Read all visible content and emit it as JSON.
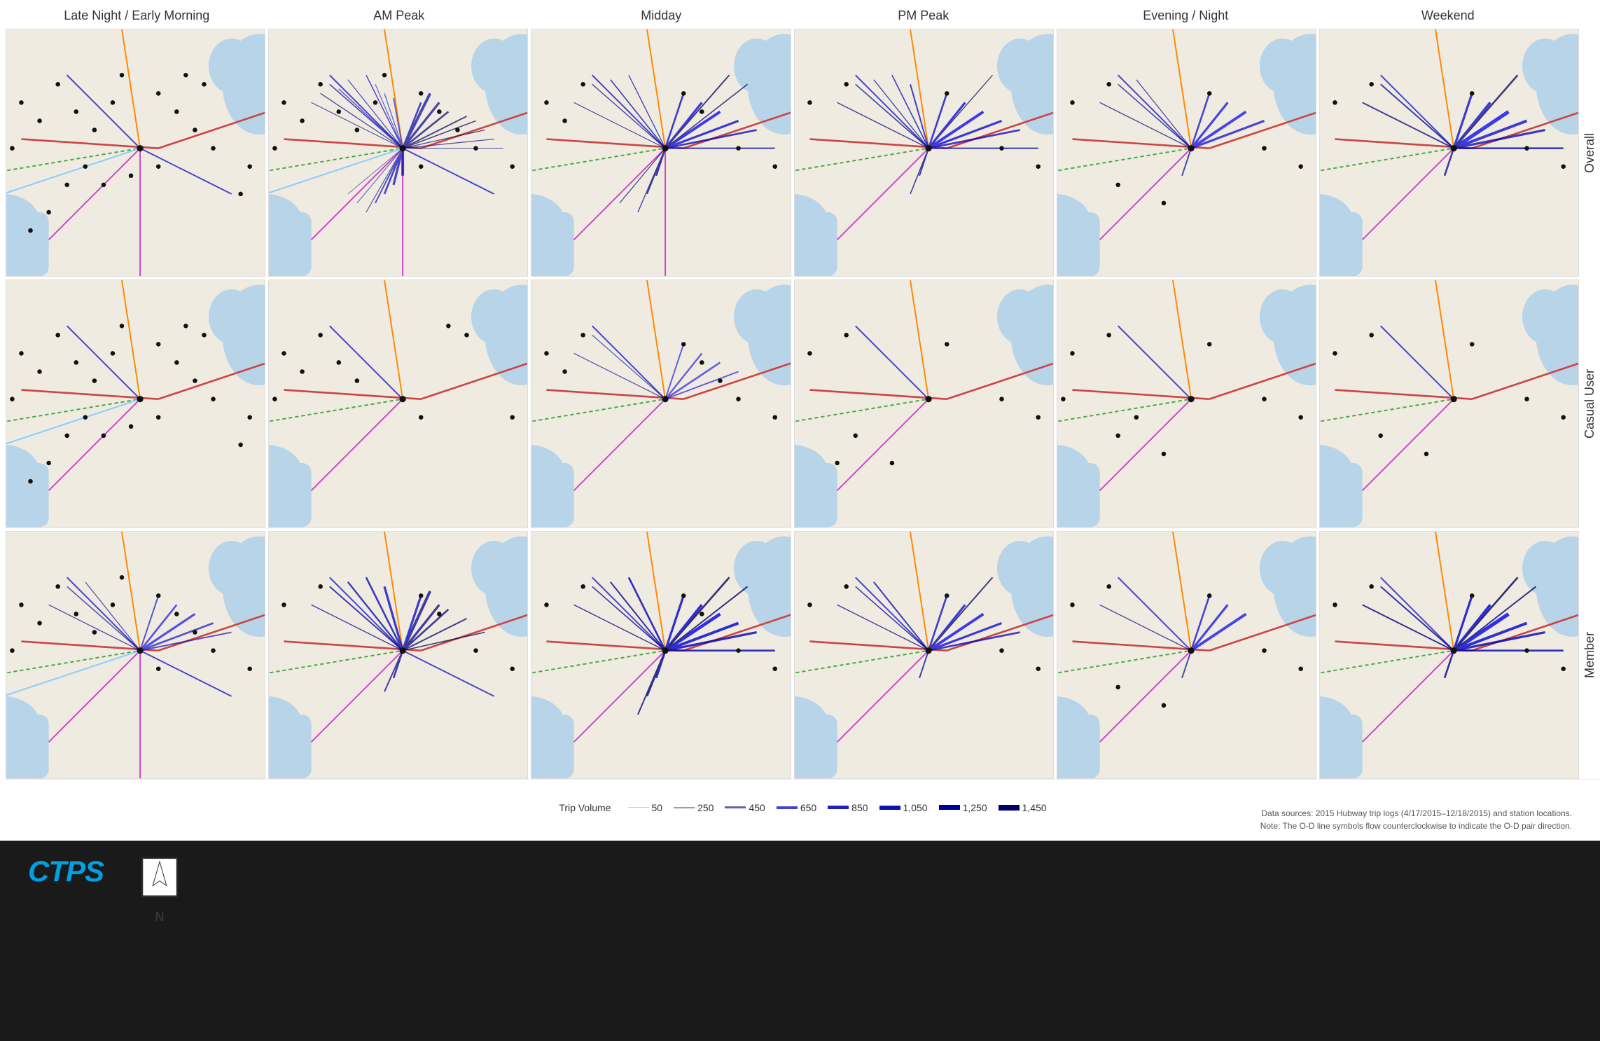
{
  "columns": [
    {
      "label": "Late Night / Early Morning"
    },
    {
      "label": "AM Peak"
    },
    {
      "label": "Midday"
    },
    {
      "label": "PM Peak"
    },
    {
      "label": "Evening / Night"
    },
    {
      "label": "Weekend"
    }
  ],
  "rows": [
    {
      "label": "Overall"
    },
    {
      "label": "Casual User"
    },
    {
      "label": "Member"
    }
  ],
  "legend": {
    "title": "Trip Volume",
    "items": [
      {
        "value": "50",
        "color": "#cccccc",
        "width": 1
      },
      {
        "value": "250",
        "color": "#9999bb",
        "width": 2
      },
      {
        "value": "450",
        "color": "#6666aa",
        "width": 3
      },
      {
        "value": "650",
        "color": "#4444cc",
        "width": 4
      },
      {
        "value": "850",
        "color": "#2222bb",
        "width": 5
      },
      {
        "value": "1,050",
        "color": "#1111aa",
        "width": 6
      },
      {
        "value": "1,250",
        "color": "#000099",
        "width": 7
      },
      {
        "value": "1,450",
        "color": "#000066",
        "width": 8
      }
    ]
  },
  "attribution": {
    "line1": "Data sources: 2015 Hubway trip logs (4/17/2015–12/18/2015) and station locations.",
    "line2": "Note: The O-D line symbols flow counterclockwise to indicate the O-D pair direction."
  },
  "north_label": "N",
  "logo_text": "CTPS"
}
